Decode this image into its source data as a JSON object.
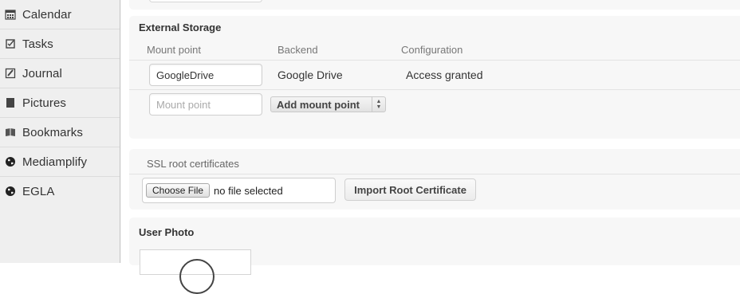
{
  "sidebar": {
    "items": [
      {
        "label": "Calendar",
        "icon": "calendar-icon"
      },
      {
        "label": "Tasks",
        "icon": "tasks-icon"
      },
      {
        "label": "Journal",
        "icon": "journal-icon"
      },
      {
        "label": "Pictures",
        "icon": "pictures-icon"
      },
      {
        "label": "Bookmarks",
        "icon": "bookmarks-icon"
      },
      {
        "label": "Mediamplify",
        "icon": "globe-icon"
      },
      {
        "label": "EGLA",
        "icon": "globe-icon"
      }
    ]
  },
  "external_storage": {
    "title": "External Storage",
    "headers": {
      "mount_point": "Mount point",
      "backend": "Backend",
      "configuration": "Configuration"
    },
    "rows": [
      {
        "mount_point": "GoogleDrive",
        "backend": "Google Drive",
        "configuration": "Access granted"
      }
    ],
    "new_mount_placeholder": "Mount point",
    "add_mount_label": "Add mount point"
  },
  "ssl": {
    "title": "SSL root certificates",
    "choose_file_label": "Choose File",
    "file_status": "no file selected",
    "import_label": "Import Root Certificate"
  },
  "user_photo": {
    "title": "User Photo"
  }
}
